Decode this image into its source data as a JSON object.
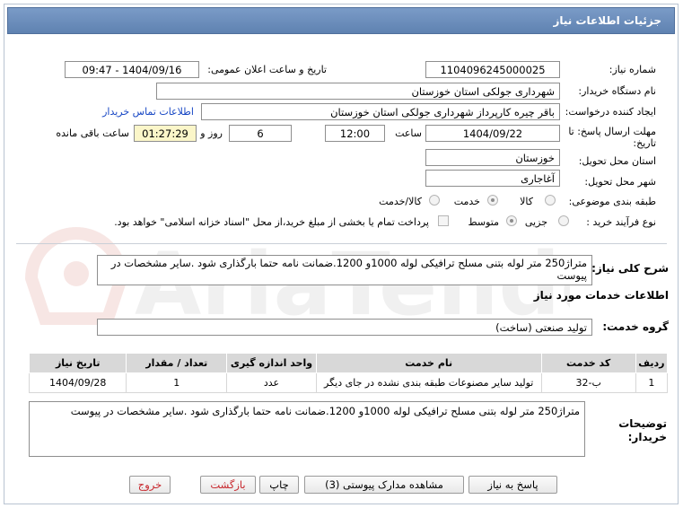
{
  "header": {
    "title": "جزئیات اطلاعات نیاز"
  },
  "watermark": {
    "text": "AriaTender.net"
  },
  "fields": {
    "need_number_label": "شماره نیاز:",
    "need_number": "1104096245000025",
    "announce_label": "تاریخ و ساعت اعلان عمومی:",
    "announce_value": "1404/09/16 - 09:47",
    "buyer_org_label": "نام دستگاه خریدار:",
    "buyer_org": "شهرداری جولکی استان خوزستان",
    "creator_label": "ایجاد کننده درخواست:",
    "creator": "باقر چیره کارپرداز شهرداری جولکی استان خوزستان",
    "contact_link": "اطلاعات تماس خریدار",
    "deadline_label_1": "مهلت ارسال پاسخ: تا",
    "deadline_label_2": "تاریخ:",
    "deadline_date": "1404/09/22",
    "hour_label": "ساعت",
    "deadline_time": "12:00",
    "days_value": "6",
    "days_label": "روز و",
    "remaining_time": "01:27:29",
    "remaining_label": "ساعت باقی مانده",
    "province_label": "استان محل تحویل:",
    "province": "خوزستان",
    "city_label": "شهر محل تحویل:",
    "city": "آغاجاری",
    "category_label": "طبقه بندی موضوعی:",
    "category_options": [
      "کالا",
      "خدمت",
      "کالا/خدمت"
    ],
    "process_label": "نوع فرآیند خرید :",
    "process_options": [
      "جزیی",
      "متوسط"
    ],
    "payment_note": "پرداخت تمام یا بخشی از مبلغ خرید،از محل \"اسناد خزانه اسلامی\" خواهد بود."
  },
  "summary": {
    "label": "شرح کلی نیاز:",
    "text": "متراژ250 متر لوله بتنی مسلح ترافیکی لوله 1000و 1200.ضمانت نامه حتما بارگذاری شود .سایر مشخصات در پیوست"
  },
  "services": {
    "section_title": "اطلاعات خدمات مورد نیاز",
    "group_label": "گروه خدمت:",
    "group_value": "تولید صنعتی (ساخت)",
    "columns": [
      "ردیف",
      "کد خدمت",
      "نام خدمت",
      "واحد اندازه گیری",
      "تعداد / مقدار",
      "تاریخ نیاز"
    ],
    "rows": [
      [
        "1",
        "ب-32",
        "تولید سایر مصنوعات طبقه بندی نشده در جای دیگر",
        "عدد",
        "1",
        "1404/09/28"
      ]
    ]
  },
  "buyer_notes": {
    "label_1": "توضیحات",
    "label_2": "خریدار:",
    "text": "متراژ250 متر لوله بتنی مسلح ترافیکی لوله 1000و 1200.ضمانت نامه حتما بارگذاری شود .سایر مشخصات در پیوست"
  },
  "buttons": {
    "reply": "پاسخ به نیاز",
    "attachments": "مشاهده مدارک پیوستی (3)",
    "print": "چاپ",
    "back": "بازگشت",
    "exit": "خروج"
  },
  "colors": {
    "title_bar": "#6b8cbb",
    "timer_bg": "#fbf6c9",
    "danger": "#c8262c",
    "link": "#1646c4"
  }
}
